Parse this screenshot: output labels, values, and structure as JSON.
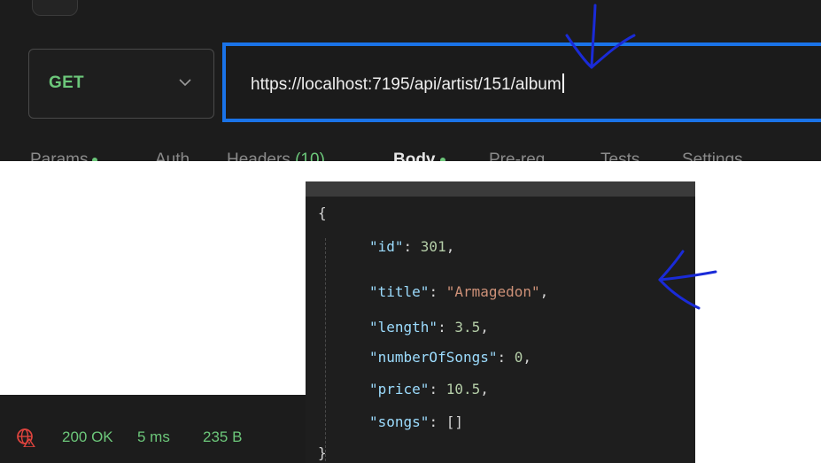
{
  "request": {
    "method": "GET",
    "url": "https://localhost:7195/api/artist/151/album"
  },
  "tabs": [
    {
      "label": "Params",
      "dot": true,
      "count": ""
    },
    {
      "label": "Auth",
      "dot": false,
      "count": ""
    },
    {
      "label": "Headers ",
      "dot": false,
      "count": "(10)"
    },
    {
      "label": "Body",
      "dot": true,
      "count": ""
    },
    {
      "label": "Pre-req.",
      "dot": false,
      "count": ""
    },
    {
      "label": "Tests",
      "dot": false,
      "count": ""
    },
    {
      "label": "Settings",
      "dot": false,
      "count": ""
    }
  ],
  "response": {
    "open_brace": "{",
    "close_brace": "}",
    "fields": [
      {
        "key": "\"id\"",
        "value": "301",
        "type": "num"
      },
      {
        "key": "\"title\"",
        "value": "\"Armagedon\"",
        "type": "str"
      },
      {
        "key": "\"length\"",
        "value": "3.5",
        "type": "num"
      },
      {
        "key": "\"numberOfSongs\"",
        "value": "0",
        "type": "num"
      },
      {
        "key": "\"price\"",
        "value": "10.5",
        "type": "num"
      },
      {
        "key": "\"songs\"",
        "value": "[]",
        "type": "punc"
      }
    ]
  },
  "status": {
    "code": "200 OK",
    "time": "5 ms",
    "size": "235 B"
  },
  "colors": {
    "accent_blue": "#1a73e8",
    "success_green": "#6cc77a",
    "json_key": "#9cdcfe",
    "json_string": "#ce9178",
    "json_number": "#b5cea8",
    "annotation_ink": "#1a2bd8"
  },
  "icons": {
    "method_dropdown": "chevron-down-icon",
    "network_status": "globe-alert-icon"
  }
}
